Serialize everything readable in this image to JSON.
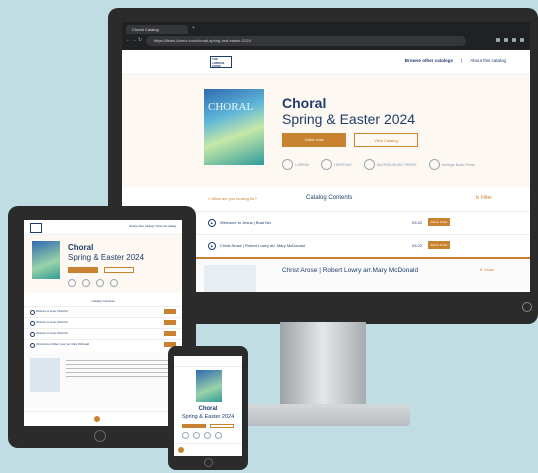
{
  "browser": {
    "tab_title": "Choral Catalog",
    "url": "https://listen.lorenz.com/choral-spring-and-easter-2024"
  },
  "site": {
    "logo_text": "THE LORENZ CORP.",
    "nav_browse": "Browse other catalogs",
    "nav_about": "About this catalog"
  },
  "hero": {
    "cover_word": "CHORAL",
    "title": "Choral",
    "subtitle": "Spring & Easter 2024",
    "order_label": "Order now",
    "view_label": "View Catalog",
    "publishers": [
      "LORENZ",
      "HERITAGE",
      "SACRED MUSIC PRESS",
      "Heritage Music Press"
    ]
  },
  "contents": {
    "search_hint": "What are you looking for?",
    "title": "Catalog Contents",
    "filter_label": "Filter",
    "tracks": [
      {
        "name": "Welcome to Jesus  |  Brad Nix",
        "duration": "03:22",
        "add_label": "Add to Order"
      },
      {
        "name": "Christ Arose  |  Robert Lowry arr. Mary McDonald",
        "duration": "03:22",
        "add_label": "Add to Order"
      }
    ]
  },
  "detail": {
    "title": "Christ Arose  |  Robert Lowry arr.Mary McDonald",
    "close_label": "Close"
  },
  "colors": {
    "accent": "#c9822f",
    "navy": "#1f3d6b",
    "background": "#bfdde3"
  }
}
